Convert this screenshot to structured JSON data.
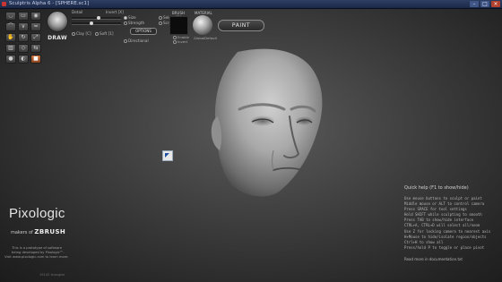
{
  "window": {
    "title": "Sculptris Alpha 6 - [SPHERE.sc1]",
    "controls": [
      "–",
      "□",
      "×"
    ]
  },
  "toolbar": {
    "tools": [
      {
        "icon": "draw-tool-icon",
        "glyph": "◡",
        "active": false
      },
      {
        "icon": "flatten-tool-icon",
        "glyph": "▭",
        "active": false
      },
      {
        "icon": "inflate-tool-icon",
        "glyph": "◉",
        "active": false
      },
      {
        "icon": "pinch-tool-icon",
        "glyph": "⌒",
        "active": false
      },
      {
        "icon": "crease-tool-icon",
        "glyph": "∨",
        "active": false
      },
      {
        "icon": "smooth-tool-icon",
        "glyph": "≈",
        "active": false
      },
      {
        "icon": "grab-tool-icon",
        "glyph": "✋",
        "active": false
      },
      {
        "icon": "rotate-tool-icon",
        "glyph": "↻",
        "active": false
      },
      {
        "icon": "scale-tool-icon",
        "glyph": "⤢",
        "active": false
      },
      {
        "icon": "mask-tool-icon",
        "glyph": "▥",
        "active": false
      },
      {
        "icon": "reduce-tool-icon",
        "glyph": "◇",
        "active": false
      },
      {
        "icon": "symmetry-tool-icon",
        "glyph": "⇆",
        "active": false
      },
      {
        "icon": "brush-a-icon",
        "glyph": "●",
        "active": false
      },
      {
        "icon": "brush-b-icon",
        "glyph": "◐",
        "active": false
      },
      {
        "icon": "paint-mode-icon",
        "glyph": "■",
        "active": true
      }
    ],
    "active_tool_label": "DRAW"
  },
  "brush_settings": {
    "detail_label": "Detail",
    "strength_label": "Strength",
    "size_label": "Size",
    "invert_label": "Invert [X]",
    "select_label": "Select [1]",
    "scroll_label": "Scroll [2]",
    "options_button": "OPTIONS",
    "clay_label": "Clay [C]",
    "soft_label": "Soft [1]",
    "directional_label": "Directional",
    "strength_value": 0.4,
    "detail_value": 0.55
  },
  "brush_panel": {
    "label": "BRUSH",
    "enable_label": "Enable",
    "invert_label": "Invert"
  },
  "material_panel": {
    "label": "MATERIAL",
    "name": "GlobalDefault"
  },
  "paint_button": "PAINT",
  "branding": {
    "logo": "Pixologic",
    "makers_prefix": "makers of",
    "product": "ZBRUSH",
    "info_lines": [
      "This is a prototype of software",
      "being developed by Pixologic™."
    ],
    "visit": "Visit www.pixologic.com to learn more."
  },
  "quick_help": {
    "title": "Quick help (F1 to show/hide)",
    "lines": [
      "Use mouse buttons to sculpt or paint",
      "Middle mouse or ALT to control camera",
      "Press SPACE for tool settings",
      "Hold SHIFT while sculpting to smooth",
      "Press TAB to show/hide interface",
      "CTRL+A, CTRL+D will select all/none",
      "Use Z for locking camera to nearest axis",
      "H+Mouse to hide/isolate region/objects",
      "Ctrl+H to show all",
      "Press/hold P to toggle or place pivot"
    ],
    "footer": "Read more in documentation.txt"
  },
  "status": {
    "triangles": "19142 triangles"
  }
}
